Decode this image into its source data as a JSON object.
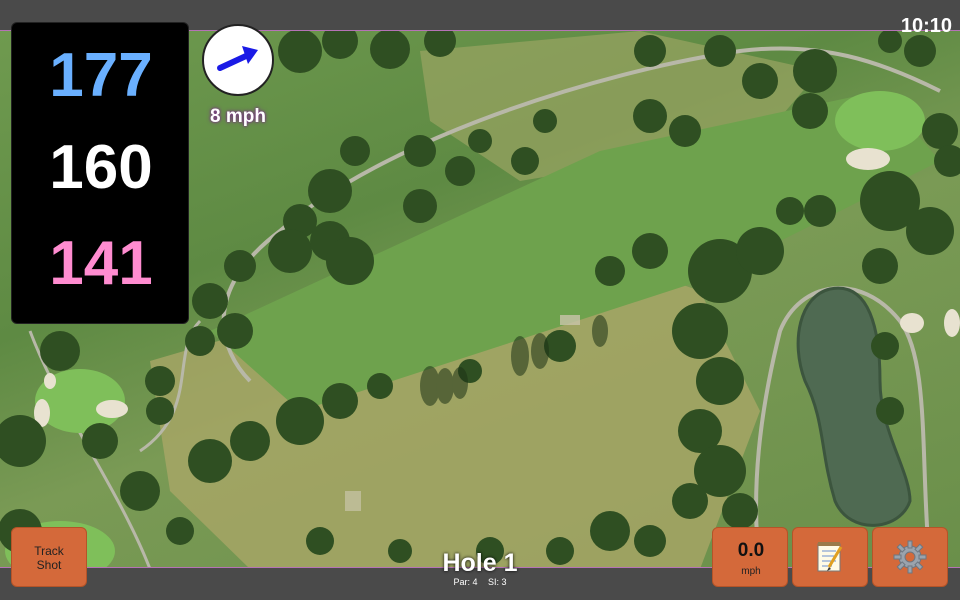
{
  "status": {
    "time": "10:10"
  },
  "distances": {
    "back": "177",
    "middle": "160",
    "front": "141"
  },
  "wind": {
    "speed": "8 mph",
    "direction_icon": "wind-arrow-icon"
  },
  "buttons": {
    "track_shot": {
      "line1": "Track",
      "line2": "Shot"
    },
    "speed": {
      "value": "0.0",
      "unit": "mph"
    },
    "notes_icon": "notepad-icon",
    "settings_icon": "gear-icon"
  },
  "hole": {
    "title": "Hole 1",
    "par": "Par: 4",
    "si": "SI: 3"
  },
  "colors": {
    "back": "#6ab0ff",
    "middle": "#ffffff",
    "front": "#ff8cd0",
    "button": "#d4693a"
  }
}
